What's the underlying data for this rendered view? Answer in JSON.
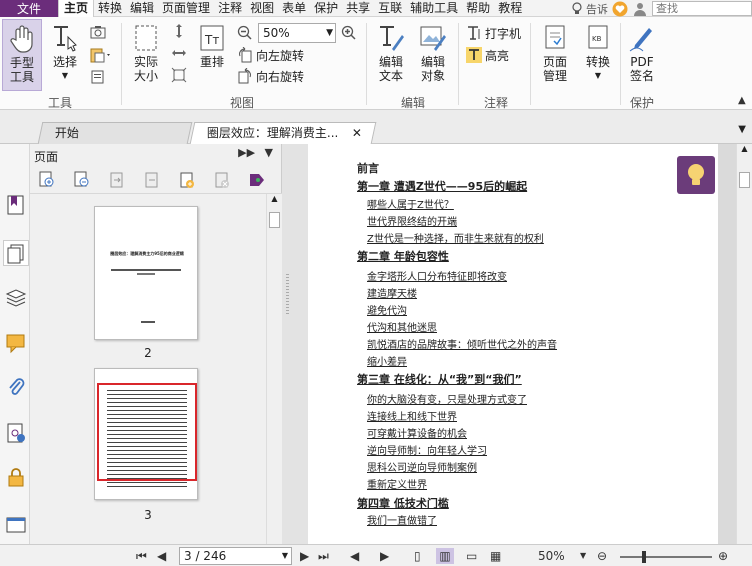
{
  "menu": {
    "file": "文件",
    "tabs": [
      "主页",
      "转换",
      "编辑",
      "页面管理",
      "注释",
      "视图",
      "表单",
      "保护",
      "共享",
      "互联",
      "辅助工具",
      "帮助",
      "教程"
    ],
    "active_tab": "主页",
    "tell_me": "告诉",
    "search_placeholder": "查找"
  },
  "ribbon": {
    "hand_tool": [
      "手型",
      "工具"
    ],
    "select": "选择",
    "actual_size": [
      "实际",
      "大小"
    ],
    "reflow": "重排",
    "zoom_value": "50%",
    "rotate_left": "向左旋转",
    "rotate_right": "向右旋转",
    "edit_text": [
      "编辑",
      "文本"
    ],
    "edit_object": [
      "编辑",
      "对象"
    ],
    "typewriter": "打字机",
    "highlight": "高亮",
    "page_manage": [
      "页面",
      "管理"
    ],
    "convert": "转换",
    "pdf_sign": [
      "PDF",
      "签名"
    ],
    "groups": {
      "tools": "工具",
      "view": "视图",
      "edit": "编辑",
      "annot": "注释",
      "protect": "保护"
    }
  },
  "tabs": {
    "start": "开始",
    "doc": "圈层效应：理解消费主..."
  },
  "panel": {
    "title": "页面",
    "page_numbers": [
      "2",
      "3"
    ],
    "thumb_title": "圈层效应：理解消费主力95后的商业逻辑"
  },
  "document": {
    "toc": [
      {
        "type": "head",
        "text": "前言"
      },
      {
        "type": "ch",
        "text": "第一章 遭遇Z世代——95后的崛起"
      },
      {
        "type": "sec",
        "text": "哪些人属于Z世代？"
      },
      {
        "type": "sec",
        "text": "世代界限终结的开端"
      },
      {
        "type": "sec",
        "text": "Z世代是一种选择，而非生来就有的权利"
      },
      {
        "type": "ch",
        "text": "第二章 年龄包容性"
      },
      {
        "type": "sec",
        "text": "金字塔形人口分布特征即将改变"
      },
      {
        "type": "sec",
        "text": "建造摩天楼"
      },
      {
        "type": "sec",
        "text": "避免代沟"
      },
      {
        "type": "sec",
        "text": "代沟和其他迷思"
      },
      {
        "type": "sec",
        "text": "凯悦酒店的品牌故事：倾听世代之外的声音"
      },
      {
        "type": "sec",
        "text": "缩小差异"
      },
      {
        "type": "ch",
        "text": "第三章 在线化：从“我”到“我们”"
      },
      {
        "type": "sec",
        "text": "你的大脑没有变，只是处理方式变了"
      },
      {
        "type": "sec",
        "text": "连接线上和线下世界"
      },
      {
        "type": "sec",
        "text": "可穿戴计算设备的机会"
      },
      {
        "type": "sec",
        "text": "逆向导师制：向年轻人学习"
      },
      {
        "type": "sec",
        "text": "思科公司逆向导师制案例"
      },
      {
        "type": "sec",
        "text": "重新定义世界"
      },
      {
        "type": "ch",
        "text": "第四章 低技术门槛"
      },
      {
        "type": "sec",
        "text": "我们一直做错了"
      }
    ]
  },
  "status": {
    "page_indicator": "3 / 246",
    "zoom": "50%"
  },
  "colors": {
    "brand": "#6b2d7b",
    "highlight_frame": "#d9262b"
  }
}
